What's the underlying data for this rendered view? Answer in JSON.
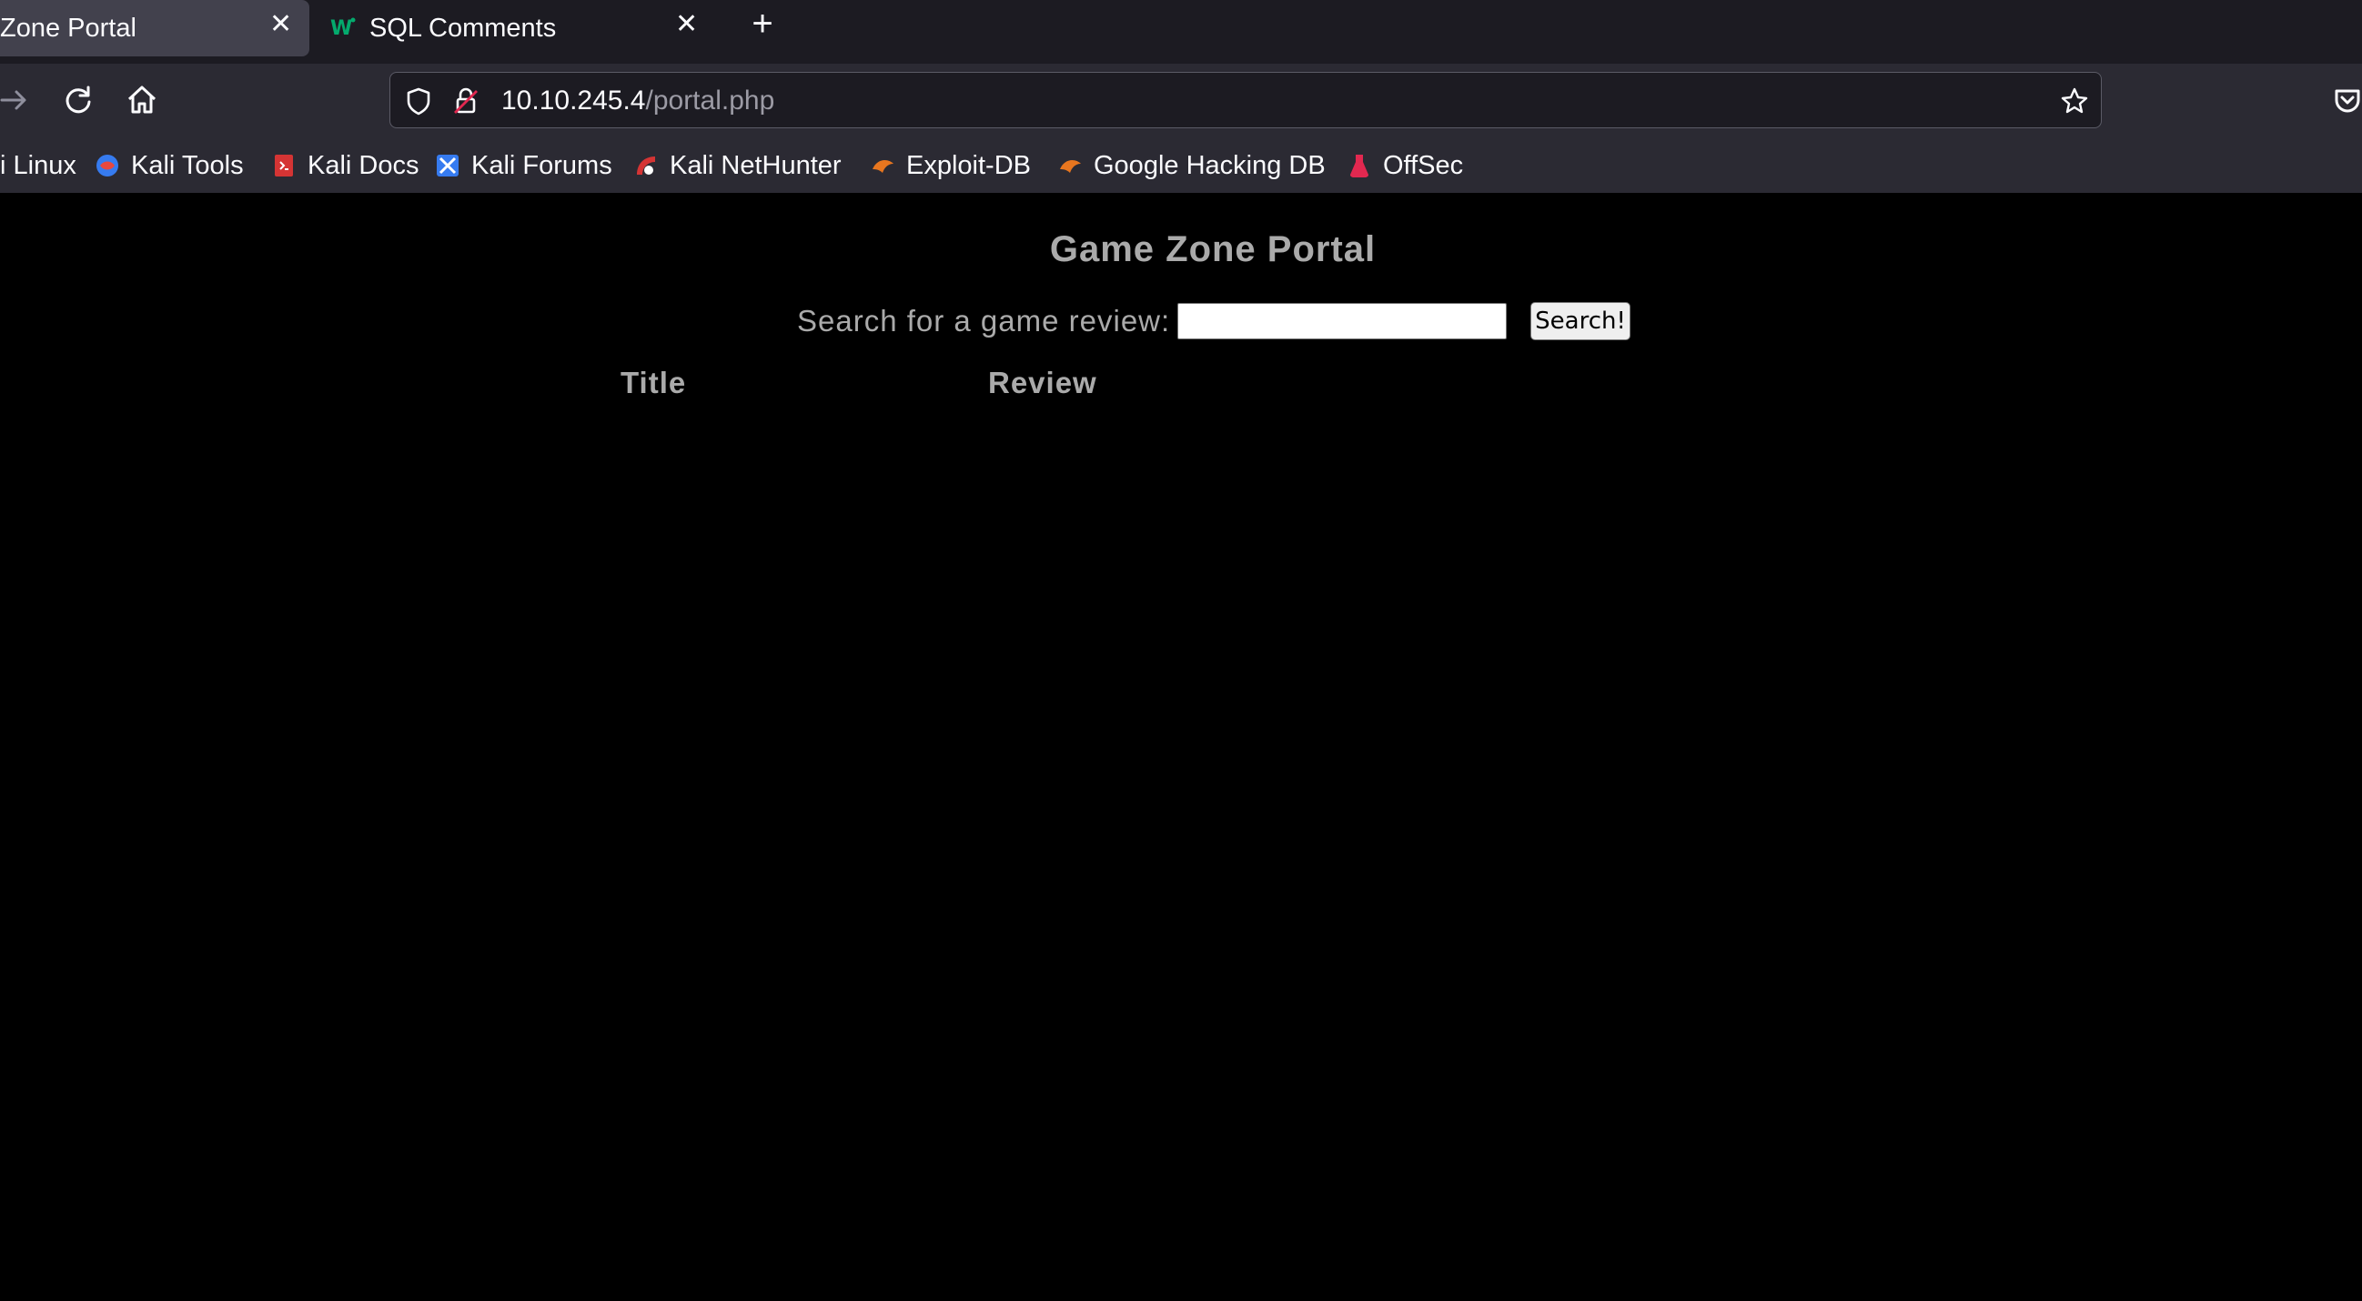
{
  "browser": {
    "tabs": [
      {
        "title": "Zone Portal",
        "active": true
      },
      {
        "title": "SQL Comments",
        "active": false
      }
    ],
    "url": {
      "host": "10.10.245.4",
      "path": "/portal.php"
    },
    "bookmarks": [
      {
        "label": "i Linux",
        "icon": "kali-icon"
      },
      {
        "label": "Kali Tools",
        "icon": "kali-tools-icon"
      },
      {
        "label": "Kali Docs",
        "icon": "kali-docs-icon"
      },
      {
        "label": "Kali Forums",
        "icon": "kali-forums-icon"
      },
      {
        "label": "Kali NetHunter",
        "icon": "nethunter-icon"
      },
      {
        "label": "Exploit-DB",
        "icon": "exploit-db-icon"
      },
      {
        "label": "Google Hacking DB",
        "icon": "ghdb-icon"
      },
      {
        "label": "OffSec",
        "icon": "offsec-icon"
      }
    ]
  },
  "page": {
    "title": "Game Zone Portal",
    "search_label": "Search for a game review:",
    "search_value": "",
    "search_button": "Search!",
    "columns": [
      "Title",
      "Review"
    ]
  },
  "colors": {
    "page_bg": "#000000",
    "page_text": "#aaaaaa",
    "toolbar_bg": "#2b2a33",
    "tabstrip_bg": "#1c1b22"
  }
}
